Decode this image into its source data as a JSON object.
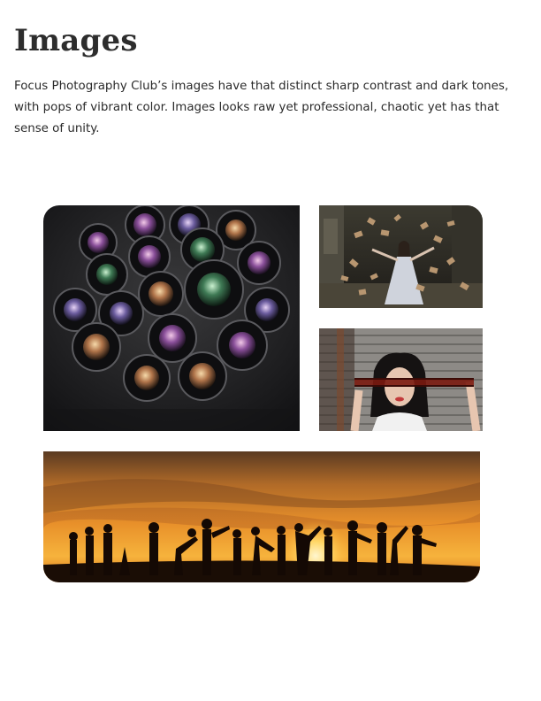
{
  "section": {
    "title": "Images",
    "description": "Focus Photography Club’s  images have that distinct sharp contrast and dark tones, with pops of vibrant color. Images looks raw yet professional, chaotic yet has that sense of unity."
  },
  "colors": {
    "heading": "#2d2d2d",
    "text": "#2a2a2a",
    "background": "#ffffff"
  }
}
